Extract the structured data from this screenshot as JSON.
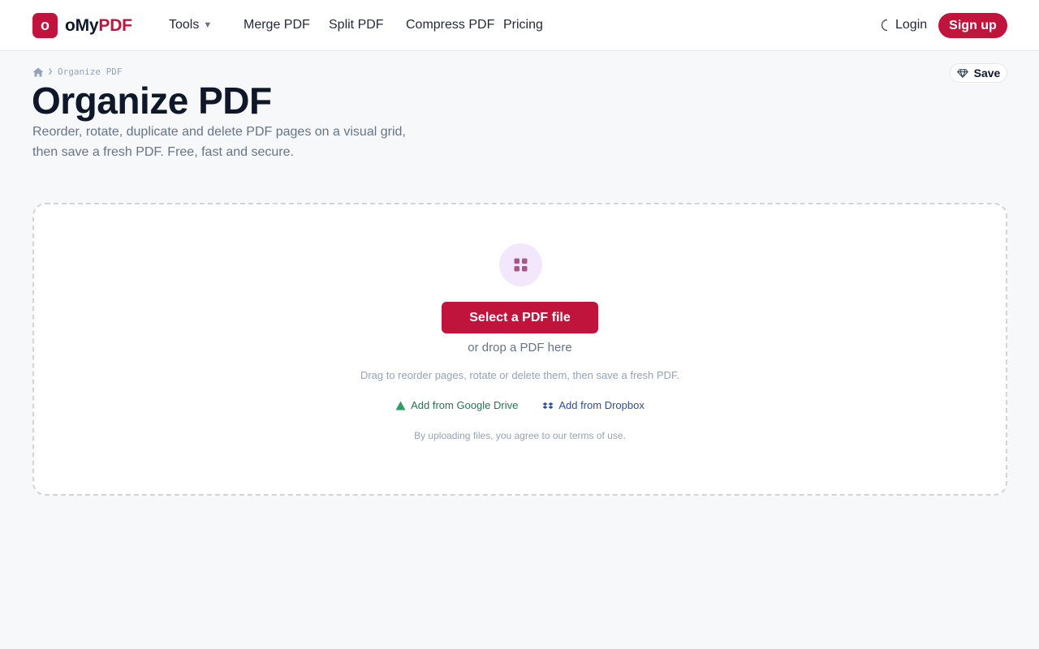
{
  "header": {
    "logo_letter": "o",
    "logo_main": "oMy",
    "logo_accent": "PDF",
    "nav": {
      "tools": "Tools",
      "merge": "Merge PDF",
      "split": "Split PDF",
      "compress": "Compress PDF",
      "pricing": "Pricing"
    },
    "login": "Login",
    "signup": "Sign up"
  },
  "breadcrumb": {
    "current": "Organize PDF"
  },
  "save_label": "Save",
  "page": {
    "title": "Organize PDF",
    "description_line1": "Reorder, rotate, duplicate and delete PDF pages on a visual grid,",
    "description_line2": "then save a fresh PDF. Free, fast and secure."
  },
  "dropzone": {
    "select_button": "Select a PDF file",
    "or_drop": "or drop a PDF here",
    "hint": "Drag to reorder pages, rotate or delete them, then save a fresh PDF.",
    "google_drive": "Add from Google Drive",
    "dropbox": "Add from Dropbox",
    "terms": "By uploading files, you agree to our terms of use."
  },
  "colors": {
    "brand": "#c0143c",
    "icon_bg": "#f3e8fb",
    "icon_fg": "#a8558f",
    "gdrive": "#1f7a4d",
    "dropbox": "#2b4f9e"
  }
}
